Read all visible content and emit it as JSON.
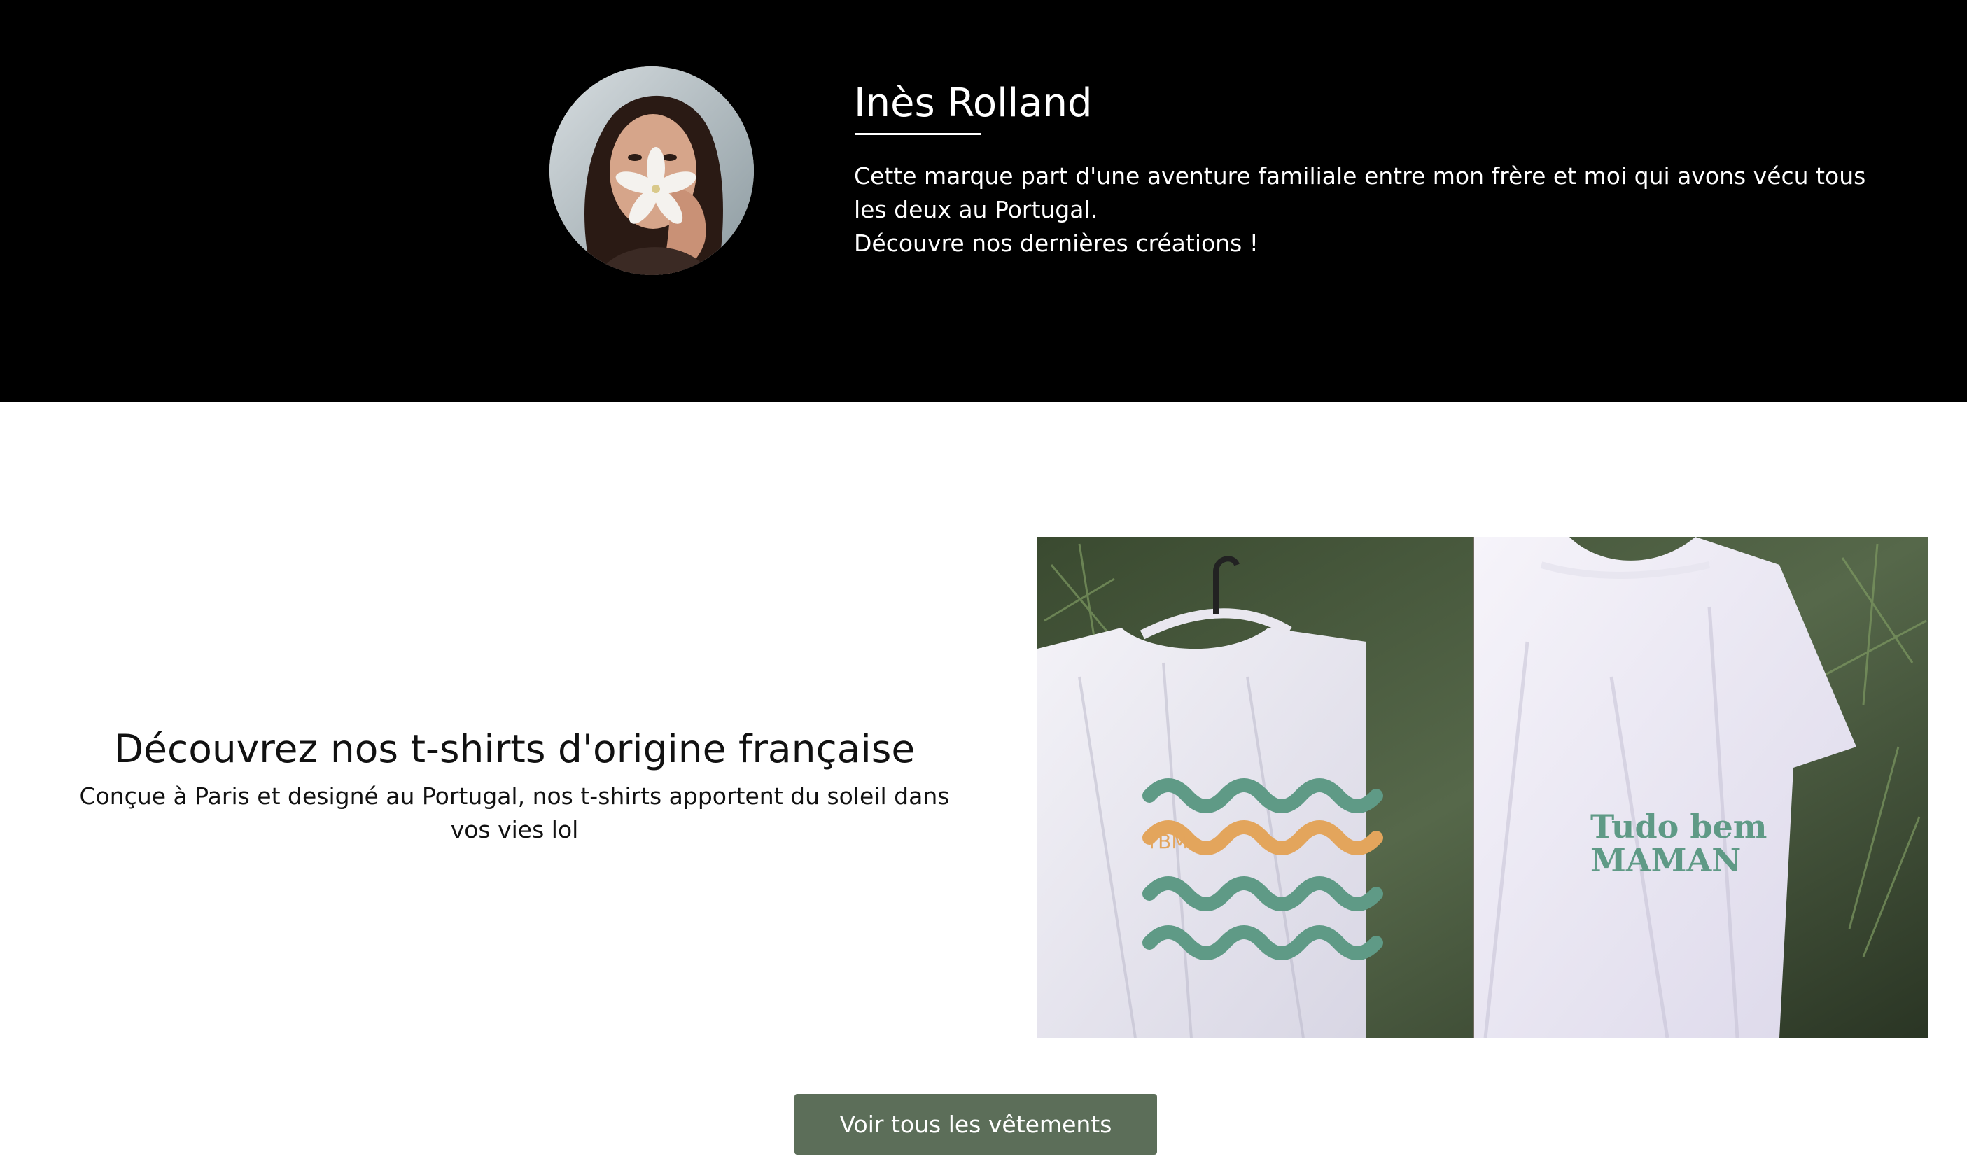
{
  "bio": {
    "name": "Inès Rolland",
    "text_line_1": "Cette marque part d'une aventure familiale entre mon frère et moi qui avons vécu tous les deux au Portugal.",
    "text_line_2": "Découvre nos dernières créations !",
    "avatar_alt": "portrait-photo"
  },
  "promo": {
    "title": "Découvrez nos t-shirts d'origine française",
    "subtitle": "Conçue à Paris et designé au Portugal, nos t-shirts apportent du soleil dans vos vies lol",
    "image_alt": "t-shirts-photo",
    "shirt_left_print": "TBM",
    "shirt_right_print_1": "Tudo bem",
    "shirt_right_print_2": "MAMAN"
  },
  "cta": {
    "label": "Voir tous les vêtements"
  },
  "colors": {
    "header_bg": "#000000",
    "cta_bg": "#5c6e59",
    "wave_green": "#5f9a86",
    "wave_orange": "#e3a55c"
  }
}
